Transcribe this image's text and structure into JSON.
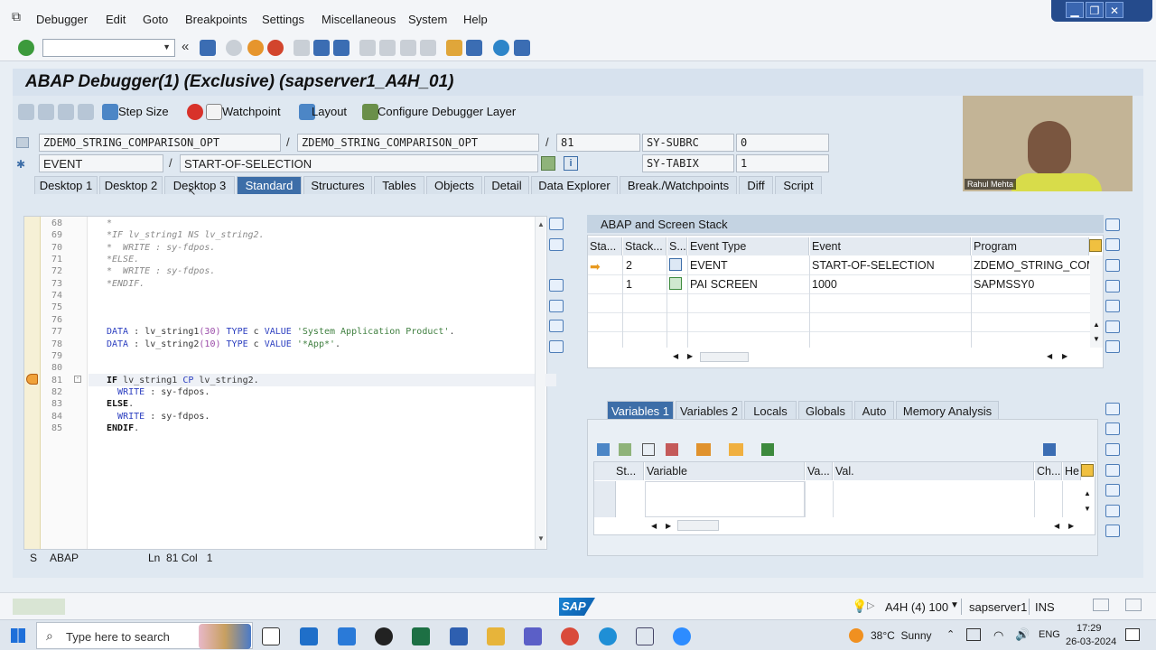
{
  "menu": [
    "Debugger",
    "Edit",
    "Goto",
    "Breakpoints",
    "Settings",
    "Miscellaneous",
    "System",
    "Help"
  ],
  "window_controls": [
    "▁",
    "❐",
    "✕"
  ],
  "toolbar": {
    "prev_label": "«"
  },
  "title": "ABAP Debugger(1)  (Exclusive) (sapserver1_A4H_01)",
  "app_toolbar": {
    "step_size": "Step Size",
    "watchpoint": "Watchpoint",
    "layout": "Layout",
    "configure_layer": "Configure Debugger Layer"
  },
  "context": {
    "program": "ZDEMO_STRING_COMPARISON_OPT",
    "include": "ZDEMO_STRING_COMPARISON_OPT",
    "line": "81",
    "event_type": "EVENT",
    "event_name": "START-OF-SELECTION",
    "slash": "/",
    "sy_subrc_label": "SY-SUBRC",
    "sy_subrc_value": "0",
    "sy_tabix_label": "SY-TABIX",
    "sy_tabix_value": "1"
  },
  "tabs": [
    {
      "label": "Desktop 1",
      "active": false
    },
    {
      "label": "Desktop 2",
      "active": false
    },
    {
      "label": "Desktop 3",
      "active": false
    },
    {
      "label": "Standard",
      "active": true
    },
    {
      "label": "Structures",
      "active": false
    },
    {
      "label": "Tables",
      "active": false
    },
    {
      "label": "Objects",
      "active": false
    },
    {
      "label": "Detail",
      "active": false
    },
    {
      "label": "Data Explorer",
      "active": false
    },
    {
      "label": "Break./Watchpoints",
      "active": false
    },
    {
      "label": "Diff",
      "active": false
    },
    {
      "label": "Script",
      "active": false
    }
  ],
  "code": {
    "lines": [
      {
        "n": "68",
        "t": "*"
      },
      {
        "n": "69",
        "t": "*IF lv_string1 NS lv_string2."
      },
      {
        "n": "70",
        "t": "*  WRITE : sy-fdpos."
      },
      {
        "n": "71",
        "t": "*ELSE."
      },
      {
        "n": "72",
        "t": "*  WRITE : sy-fdpos."
      },
      {
        "n": "73",
        "t": "*ENDIF."
      },
      {
        "n": "74",
        "t": ""
      },
      {
        "n": "75",
        "t": ""
      },
      {
        "n": "76",
        "t": ""
      },
      {
        "n": "77",
        "t": "DATA : lv_string1(30) TYPE c VALUE 'System Application Product'."
      },
      {
        "n": "78",
        "t": "DATA : lv_string2(10) TYPE c VALUE '*App*'."
      },
      {
        "n": "79",
        "t": ""
      },
      {
        "n": "80",
        "t": ""
      },
      {
        "n": "81",
        "t": "IF lv_string1 CP lv_string2."
      },
      {
        "n": "82",
        "t": "  WRITE : sy-fdpos."
      },
      {
        "n": "83",
        "t": "ELSE."
      },
      {
        "n": "84",
        "t": "  WRITE : sy-fdpos."
      },
      {
        "n": "85",
        "t": "ENDIF."
      }
    ],
    "status": {
      "mode": "S",
      "lang": "ABAP",
      "position": "Ln  81 Col   1"
    }
  },
  "stack": {
    "title": "ABAP and Screen Stack",
    "columns": [
      "Sta...",
      "Stack...",
      "S...",
      "Event Type",
      "Event",
      "Program"
    ],
    "rows": [
      {
        "level": "2",
        "event_type": "EVENT",
        "event": "START-OF-SELECTION",
        "program": "ZDEMO_STRING_COMI"
      },
      {
        "level": "1",
        "event_type": "PAI SCREEN",
        "event": "1000",
        "program": "SAPMSSY0"
      }
    ]
  },
  "variables": {
    "tabs": [
      {
        "label": "Variables 1",
        "active": true
      },
      {
        "label": "Variables 2",
        "active": false
      },
      {
        "label": "Locals",
        "active": false
      },
      {
        "label": "Globals",
        "active": false
      },
      {
        "label": "Auto",
        "active": false
      },
      {
        "label": "Memory Analysis",
        "active": false
      }
    ],
    "columns": [
      "St...",
      "Variable",
      "Va...",
      "Val.",
      "Ch...",
      "He"
    ]
  },
  "webcam": {
    "name": "Rahul Mehta"
  },
  "statusbar": {
    "system": "A4H (4) 100",
    "server": "sapserver1",
    "mode": "INS",
    "logo": "SAP"
  },
  "taskbar": {
    "search_placeholder": "Type here to search",
    "weather": "38°C  Sunny",
    "lang": "ENG",
    "time": "17:29",
    "date": "26-03-2024"
  },
  "colors": {
    "active_tab": "#3d6ea8",
    "title_band": "#d7e2ee",
    "comment": "#8a8a8a",
    "keyword": "#2c3fc0",
    "string": "#3f7f3f"
  }
}
